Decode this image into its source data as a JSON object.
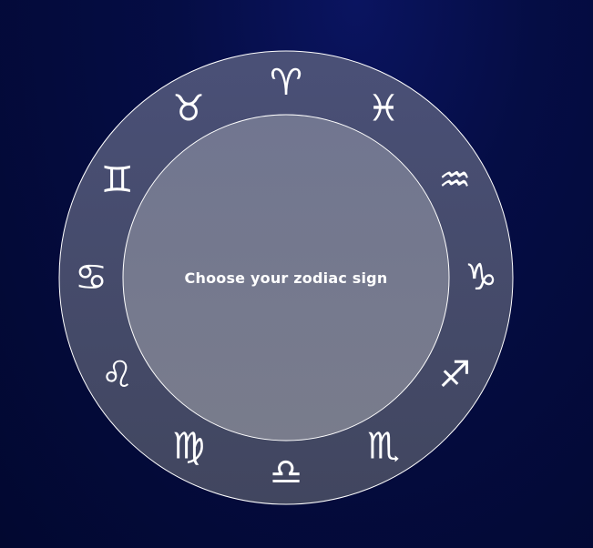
{
  "wheel": {
    "center_label": "Choose your zodiac sign",
    "signs": [
      {
        "name": "aries",
        "glyph": "♈︎",
        "angle": 0
      },
      {
        "name": "pisces",
        "glyph": "♓︎",
        "angle": 30
      },
      {
        "name": "aquarius",
        "glyph": "♒︎",
        "angle": 60
      },
      {
        "name": "capricorn",
        "glyph": "♑︎",
        "angle": 90
      },
      {
        "name": "sagittarius",
        "glyph": "♐︎",
        "angle": 120
      },
      {
        "name": "scorpio",
        "glyph": "♏︎",
        "angle": 150
      },
      {
        "name": "libra",
        "glyph": "♎︎",
        "angle": 180
      },
      {
        "name": "virgo",
        "glyph": "♍︎",
        "angle": 210
      },
      {
        "name": "leo",
        "glyph": "♌︎",
        "angle": 240
      },
      {
        "name": "cancer",
        "glyph": "♋︎",
        "angle": 270
      },
      {
        "name": "gemini",
        "glyph": "♊︎",
        "angle": 300
      },
      {
        "name": "taurus",
        "glyph": "♉︎",
        "angle": 330
      }
    ]
  },
  "colors": {
    "background": "#020830",
    "outer_ring": "#454a6c",
    "inner_disc": "#767a90",
    "stroke": "#ffffff"
  }
}
